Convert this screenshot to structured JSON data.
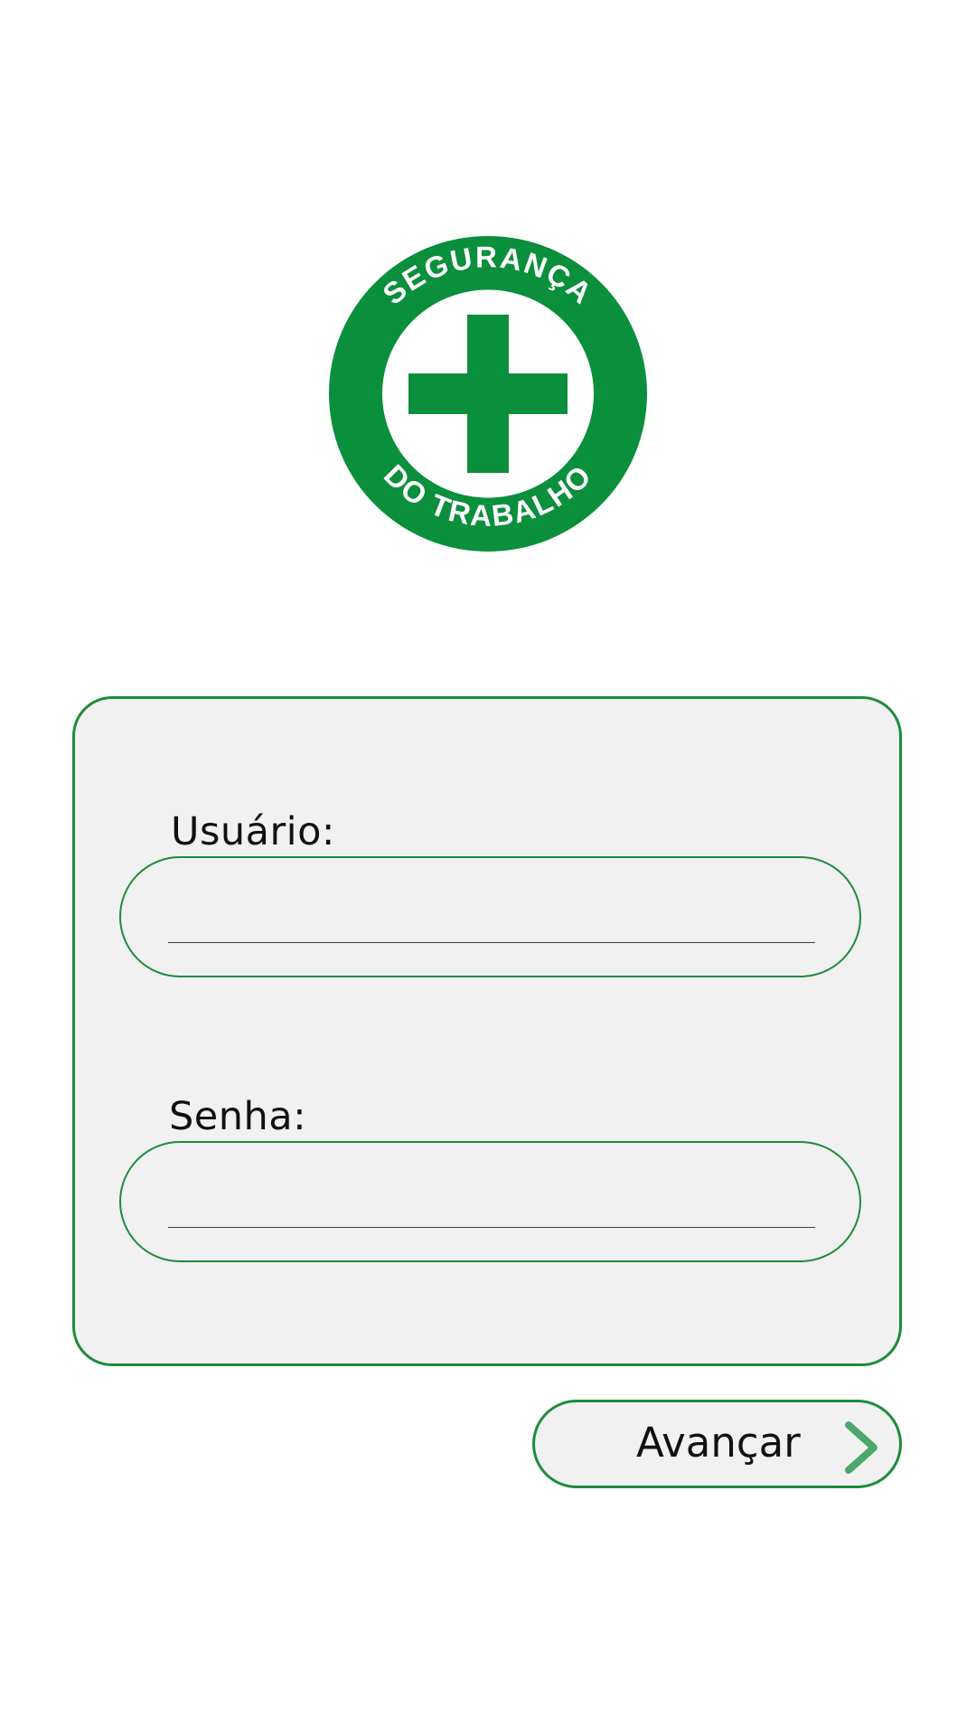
{
  "logo": {
    "top_text": "SEGURANÇA",
    "bottom_text": "DO TRABALHO",
    "color": "#0a8f3c"
  },
  "form": {
    "user_label": "Usuário:",
    "user_value": "",
    "password_label": "Senha:",
    "password_value": ""
  },
  "actions": {
    "next_label": "Avançar"
  },
  "colors": {
    "accent": "#1e8c3c",
    "panel_bg": "#f1f1f1",
    "chevron": "#4aa86a"
  },
  "icons": {
    "next": "chevron-right-icon"
  }
}
